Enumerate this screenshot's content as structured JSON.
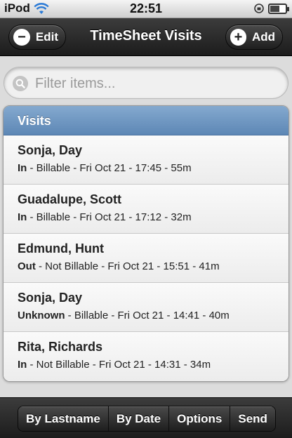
{
  "status_bar": {
    "carrier": "iPod",
    "time": "22:51",
    "wifi_icon": "wifi-icon",
    "lock_icon": "orientation-lock-icon",
    "battery_level": 0.6
  },
  "header": {
    "title": "TimeSheet Visits",
    "edit_label": "Edit",
    "edit_icon": "minus-icon",
    "add_label": "Add",
    "add_icon": "plus-icon"
  },
  "search": {
    "placeholder": "Filter items...",
    "value": "",
    "icon": "search-icon"
  },
  "list": {
    "header": "Visits",
    "items": [
      {
        "name": "Sonja, Day",
        "status": "In",
        "detail": " - Billable - Fri Oct 21 - 17:45 - 55m"
      },
      {
        "name": "Guadalupe, Scott",
        "status": "In",
        "detail": " - Billable - Fri Oct 21 - 17:12 - 32m"
      },
      {
        "name": "Edmund, Hunt",
        "status": "Out",
        "detail": " - Not Billable - Fri Oct 21 - 15:51 - 41m"
      },
      {
        "name": "Sonja, Day",
        "status": "Unknown",
        "detail": " - Billable - Fri Oct 21 - 14:41 - 40m"
      },
      {
        "name": "Rita, Richards",
        "status": "In",
        "detail": " - Not Billable - Fri Oct 21 - 14:31 - 34m"
      }
    ]
  },
  "footer": {
    "buttons": [
      "By Lastname",
      "By Date",
      "Options",
      "Send"
    ]
  },
  "colors": {
    "list_header": "#6f97c3",
    "bar_dark": "#2a2a2a",
    "background": "#dcdcdc"
  }
}
